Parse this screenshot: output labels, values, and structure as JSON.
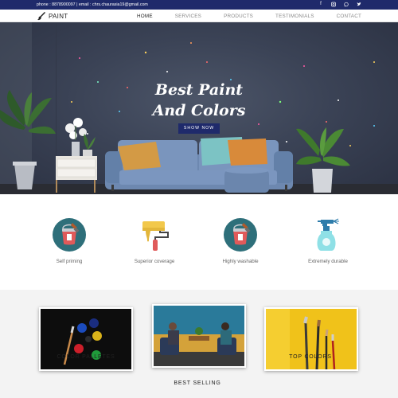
{
  "topbar": {
    "contact_text": "phone : 8878900097 | email : chrs.chaurasia19@gmail.com",
    "social_icons": [
      "facebook-icon",
      "instagram-icon",
      "whatsapp-icon",
      "twitter-icon"
    ]
  },
  "nav": {
    "brand": "PAINT",
    "items": [
      {
        "label": "HOME",
        "active": true
      },
      {
        "label": "SERVICES",
        "active": false
      },
      {
        "label": "PRODUCTS",
        "active": false
      },
      {
        "label": "TESTIMONIALS",
        "active": false
      },
      {
        "label": "CONTACT",
        "active": false
      }
    ]
  },
  "hero": {
    "title_line1": "Best Paint",
    "title_line2": "And Colors",
    "button_label": "SHOW NOW"
  },
  "features": [
    {
      "icon": "paint-bucket-icon",
      "label": "Self priming"
    },
    {
      "icon": "paint-roller-icon",
      "label": "Superior coverage"
    },
    {
      "icon": "paint-bucket-icon",
      "label": "Highly washable"
    },
    {
      "icon": "spray-bottle-icon",
      "label": "Extremely durable"
    }
  ],
  "products": [
    {
      "label": "COLOR PALLETES"
    },
    {
      "label": "BEST SELLING"
    },
    {
      "label": "TOP COLORS"
    }
  ],
  "colors": {
    "brand_navy": "#1f2a6b",
    "hero_wall": "#3b4356",
    "feature_circle": "#2e6f7a"
  }
}
